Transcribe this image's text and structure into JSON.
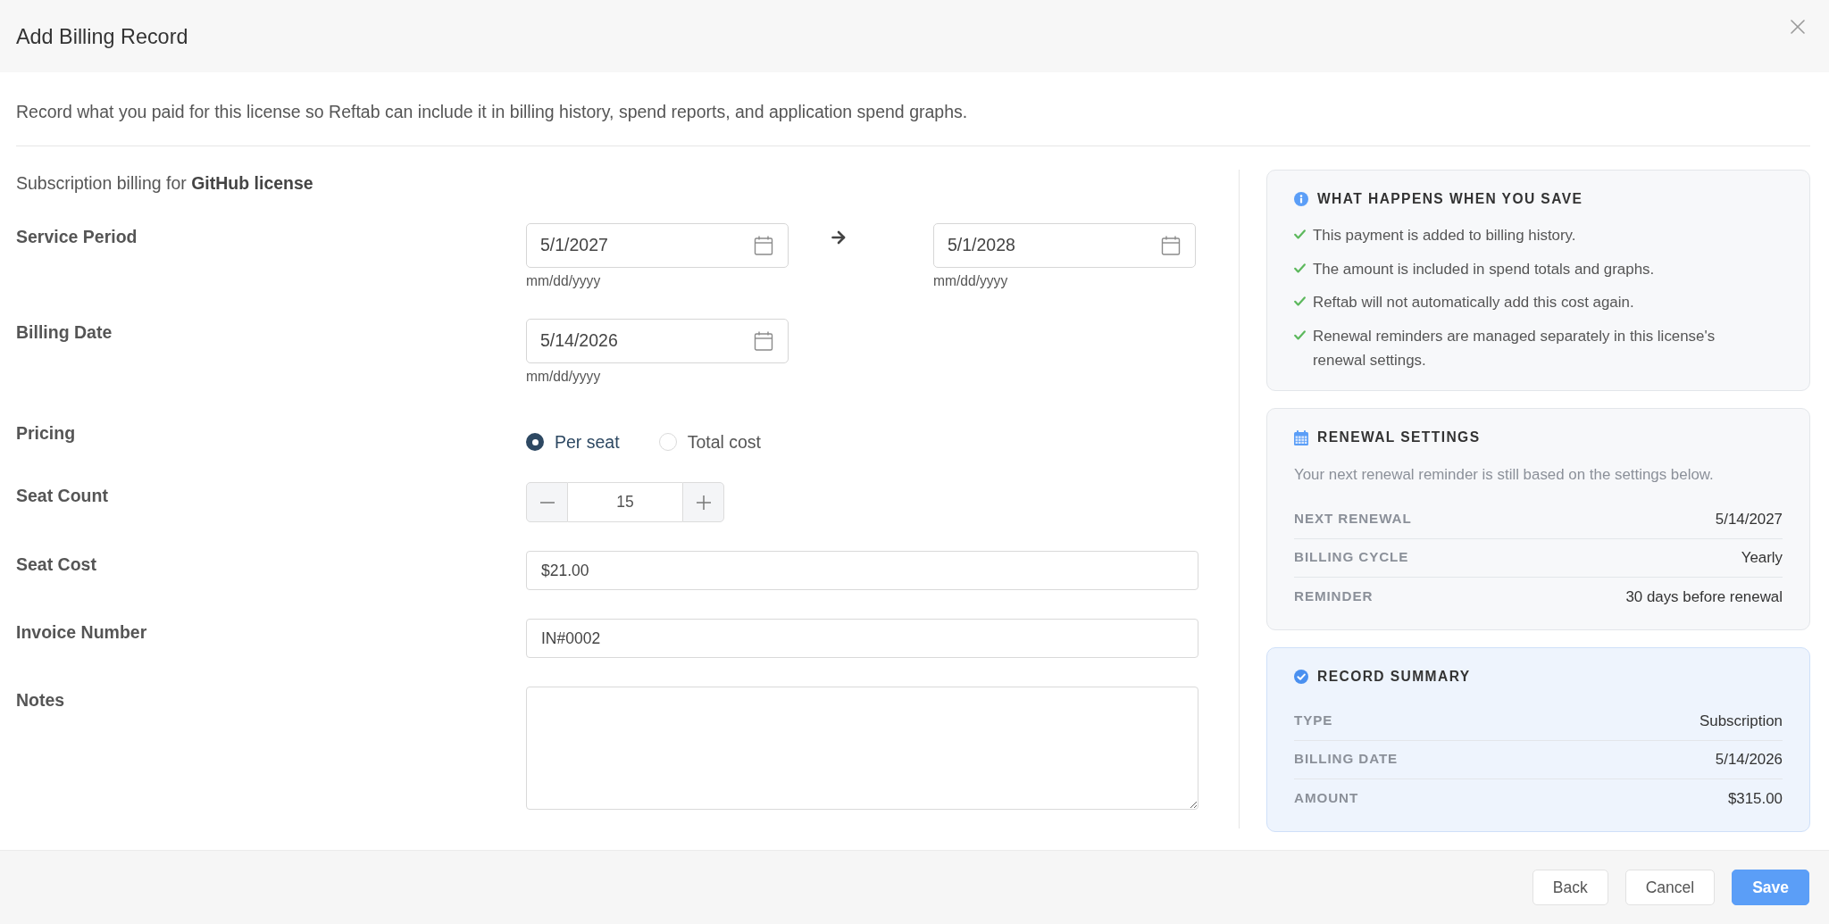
{
  "dialog": {
    "title": "Add Billing Record"
  },
  "description": "Record what you paid for this license so Reftab can include it in billing history, spend reports, and application spend graphs.",
  "form": {
    "subtitle": "Subscription billing for **GitHub license**",
    "fields": [
      {
        "kind": "date_range",
        "label": "Service Period",
        "start": {
          "value": "5/1/2027",
          "hint": "mm/dd/yyyy"
        },
        "end": {
          "value": "5/1/2028",
          "hint": "mm/dd/yyyy"
        }
      },
      {
        "kind": "date",
        "label": "Billing Date",
        "value": "5/14/2026",
        "hint": "mm/dd/yyyy"
      },
      {
        "kind": "radio",
        "label": "Pricing",
        "options": [
          {
            "label": "Per seat",
            "selected": true
          },
          {
            "label": "Total cost",
            "selected": false
          }
        ]
      },
      {
        "kind": "stepper",
        "label": "Seat Count",
        "value": "15"
      },
      {
        "kind": "text",
        "label": "Seat Cost",
        "value": "$21.00"
      },
      {
        "kind": "text",
        "label": "Invoice Number",
        "value": "IN#0002"
      },
      {
        "kind": "textarea",
        "label": "Notes"
      }
    ]
  },
  "sidebar": {
    "cards": [
      {
        "kind": "checklist",
        "title": "WHAT HAPPENS WHEN YOU SAVE",
        "items": [
          "This payment is added to billing history.",
          "The amount is included in spend totals and graphs.",
          "Reftab will not automatically add this cost again.",
          "Renewal reminders are managed separately in this license's renewal settings."
        ]
      },
      {
        "kind": "settings",
        "title": "RENEWAL SETTINGS",
        "description": "Your next renewal reminder is still based on the settings below.",
        "rows": [
          {
            "label": "NEXT RENEWAL",
            "value": "5/14/2027"
          },
          {
            "label": "BILLING CYCLE",
            "value": "Yearly"
          },
          {
            "label": "REMINDER",
            "value": "30 days before renewal"
          }
        ]
      },
      {
        "kind": "summary",
        "title": "RECORD SUMMARY",
        "rows": [
          {
            "label": "TYPE",
            "value": "Subscription"
          },
          {
            "label": "BILLING DATE",
            "value": "5/14/2026"
          },
          {
            "label": "AMOUNT",
            "value": "$315.00"
          }
        ]
      }
    ]
  },
  "footer": {
    "buttons": [
      {
        "label": "Back",
        "kind": "secondary"
      },
      {
        "label": "Cancel",
        "kind": "secondary"
      },
      {
        "label": "Save",
        "kind": "primary"
      }
    ]
  }
}
